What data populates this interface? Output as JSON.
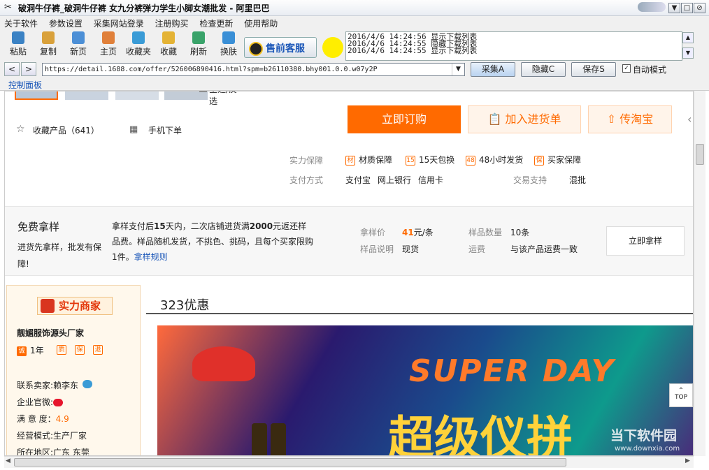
{
  "window": {
    "title": "破洞牛仔裤_破洞牛仔裤 女九分裤弹力学生小脚女潮批发 - 阿里巴巴",
    "min": "▼",
    "max": "□",
    "close": "⊘"
  },
  "menu": [
    "关于软件",
    "参数设置",
    "采集网站登录",
    "注册购买",
    "检查更新",
    "使用帮助"
  ],
  "toolbar": {
    "buttons": [
      {
        "label": "粘贴",
        "icon": "paste-icon",
        "color": "#3b82c4"
      },
      {
        "label": "复制",
        "icon": "copy-icon",
        "color": "#d9a13b"
      },
      {
        "label": "新页",
        "icon": "new-page-icon",
        "color": "#4c8fd6"
      },
      {
        "label": "主页",
        "icon": "home-icon",
        "color": "#e0803a"
      },
      {
        "label": "收藏夹",
        "icon": "favorites-icon",
        "color": "#3a9bd6"
      },
      {
        "label": "收藏",
        "icon": "collect-icon",
        "color": "#e4b335"
      },
      {
        "label": "刷新",
        "icon": "refresh-icon",
        "color": "#3aa36a"
      },
      {
        "label": "换肤",
        "icon": "skin-icon",
        "color": "#3a8fd6"
      }
    ],
    "qq_label": "售前客服",
    "log": [
      "2016/4/6 14:24:56 显示下载列表",
      "2016/4/6 14:24:55 隐藏下载列表",
      "2016/4/6 14:24:55 显示下载列表"
    ]
  },
  "address": {
    "url": "https://detail.1688.com/offer/526006890416.html?spm=b26110380.bhy001.0.0.w07y2P",
    "collect": "采集A",
    "hide": "隐藏C",
    "save": "保存S",
    "auto": "自动模式",
    "back": "<",
    "forward": ">"
  },
  "panel": {
    "label": "控制面板",
    "select_all": "全选/反选"
  },
  "page": {
    "buy_now": "立即订购",
    "add_cart": "加入进货单",
    "to_taobao": "传淘宝",
    "collect": "收藏产品（641）",
    "mobile": "手机下单",
    "guarantee_label": "实力保障",
    "guarantees": [
      "材质保障",
      "15天包换",
      "48小时发货",
      "买家保障"
    ],
    "guarantee_icons": [
      "材",
      "15",
      "48",
      "保"
    ],
    "pay_label": "支付方式",
    "pays": [
      "支付宝",
      "网上银行",
      "信用卡"
    ],
    "trade_label": "交易支持",
    "trade_value": "混批",
    "sample_title": "免费拿样",
    "sample_sub": "进货先拿样，批发有保障!",
    "sample_desc_a": "拿样支付后",
    "sample_desc_b": "15",
    "sample_desc_c": "天内，二次店铺进货满",
    "sample_desc_d": "2000",
    "sample_desc_e": "元返还样品费。样品随机发货，不挑色、挑码，且每个买家限购1件。",
    "sample_rule": "拿样规则",
    "price_label": "拿样价",
    "price_value": "41",
    "price_unit": "元/条",
    "qty_label": "样品数量",
    "qty_value": "10条",
    "note_label": "样品说明",
    "note_value": "现货",
    "ship_label": "运费",
    "ship_value": "与该产品运费一致",
    "sample_btn": "立即拿样",
    "badge": "实力商家",
    "shop": "靓媚服饰源头厂家",
    "years": "1年",
    "year_icon": "诚",
    "shop_icons": [
      "质",
      "保",
      "退"
    ],
    "contact_label": "联系卖家:",
    "contact_value": "赖李东",
    "weibo_label": "企业官微:",
    "rating_label": "满 意 度：",
    "rating_value": "4.9",
    "mode_label": "经营模式:",
    "mode_value": "生产厂家",
    "area_label": "所在地区:",
    "area_value": "广东 东莞",
    "promo_title": "323优惠",
    "banner_text1": "SUPER DAY",
    "banner_text2": "超级仪拼",
    "top": "TOP",
    "watermark": "当下软件园",
    "watermark_url": "www.downxia.com"
  }
}
